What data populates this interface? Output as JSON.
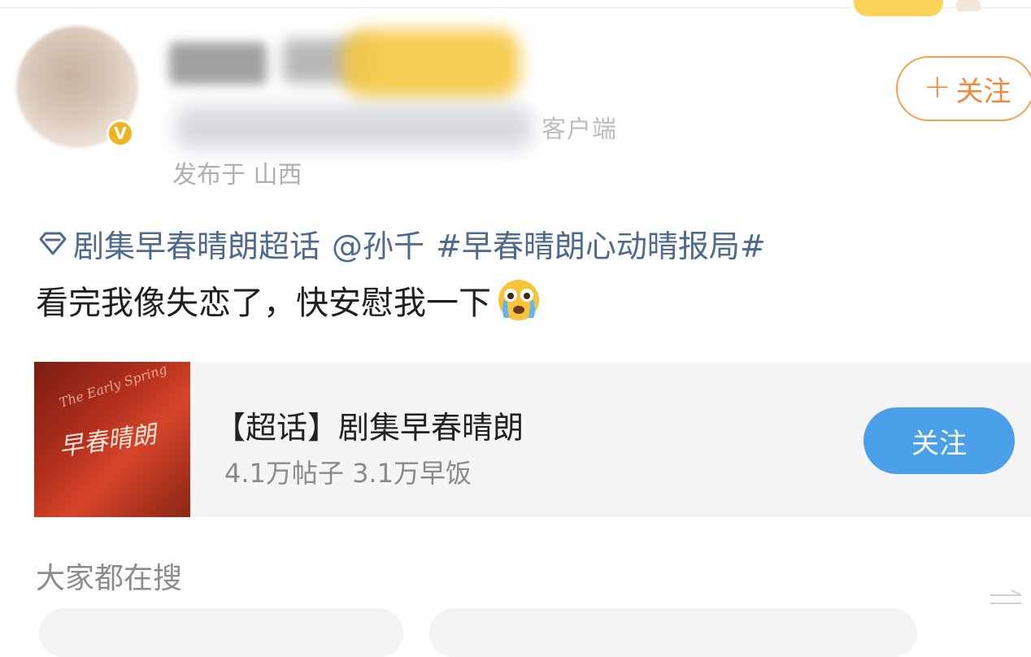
{
  "header": {
    "client_suffix": "客户端",
    "post_location": "发布于 山西",
    "follow_label": "关注",
    "verified_badge": "V"
  },
  "post": {
    "topic_link": "剧集早春晴朗超话",
    "mention": "@孙千",
    "hashtag": "#早春晴朗心动晴报局#",
    "body": "看完我像失恋了，快安慰我一下"
  },
  "card": {
    "thumb_title": "早春晴朗",
    "thumb_subtitle": "The Early Spring",
    "title": "【超话】剧集早春晴朗",
    "stats": "4.1万帖子 3.1万早饭",
    "follow_label": "关注"
  },
  "search": {
    "heading": "大家都在搜"
  },
  "colors": {
    "link": "#4e6a8e",
    "follow_orange": "#f0893a",
    "follow_blue": "#4aa0e9",
    "badge_gold": "#f0b21e"
  },
  "icons": [
    "diamond-icon",
    "cry-emoji-icon",
    "plus-icon",
    "verified-icon",
    "more-icon"
  ]
}
